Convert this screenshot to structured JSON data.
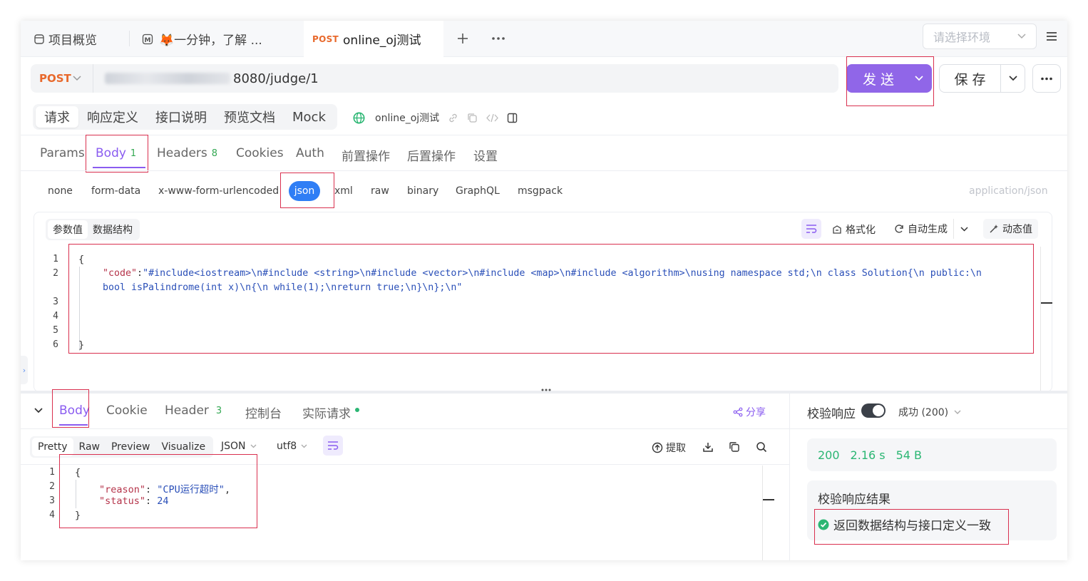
{
  "tabs": [
    {
      "label": "项目概览"
    },
    {
      "label": "🦊一分钟，了解 ..."
    },
    {
      "method": "POST",
      "label": "online_oj测试"
    }
  ],
  "env_placeholder": "请选择环境",
  "request": {
    "method": "POST",
    "url": "8080/judge/1",
    "send_label": "发 送",
    "save_label": "保 存"
  },
  "main_tabs": [
    "请求",
    "响应定义",
    "接口说明",
    "预览文档",
    "Mock"
  ],
  "api_name": "online_oj测试",
  "sub_tabs": [
    {
      "label": "Params"
    },
    {
      "label": "Body",
      "count": "1"
    },
    {
      "label": "Headers",
      "count": "8"
    },
    {
      "label": "Cookies"
    },
    {
      "label": "Auth"
    },
    {
      "label": "前置操作"
    },
    {
      "label": "后置操作"
    },
    {
      "label": "设置"
    }
  ],
  "body_types": [
    "none",
    "form-data",
    "x-www-form-urlencoded",
    "json",
    "xml",
    "raw",
    "binary",
    "GraphQL",
    "msgpack"
  ],
  "content_type": "application/json",
  "editor": {
    "tabs": [
      "参数值",
      "数据结构"
    ],
    "tools": {
      "format": "格式化",
      "auto": "自动生成",
      "dynamic": "动态值"
    },
    "line_numbers": [
      "1",
      "2",
      "3",
      "4",
      "5",
      "6"
    ],
    "lines": {
      "l1": "{",
      "l2_key": "\"code\"",
      "l2_colon": ":",
      "l2_val_a": "\"#include<iostream>\\n#include <string>\\n#include <vector>\\n#include <map>\\n#include <algorithm>\\nusing namespace std;\\n class Solution{\\n public:\\n",
      "l2_val_b": "bool isPalindrome(int x)\\n{\\n while(1);\\nreturn true;\\n}\\n};\\n\"",
      "l6": "}"
    }
  },
  "response": {
    "tabs": [
      {
        "label": "Body"
      },
      {
        "label": "Cookie"
      },
      {
        "label": "Header",
        "count": "3"
      },
      {
        "label": "控制台"
      },
      {
        "label": "实际请求"
      }
    ],
    "share": "分享",
    "views": [
      "Pretty",
      "Raw",
      "Preview",
      "Visualize"
    ],
    "format": "JSON",
    "encoding": "utf8",
    "extract": "提取",
    "line_numbers": [
      "1",
      "2",
      "3",
      "4"
    ],
    "lines": {
      "l1": "{",
      "reason_key": "\"reason\"",
      "reason_val": "\"CPU运行超时\"",
      "status_key": "\"status\"",
      "status_val": "24",
      "l4": "}"
    }
  },
  "validation": {
    "label": "校验响应",
    "result_status": "成功 (200)",
    "status_code": "200",
    "time": "2.16 s",
    "size": "54 B",
    "result_title": "校验响应结果",
    "result_msg": "返回数据结构与接口定义一致"
  },
  "colors": {
    "accent": "#9066e8",
    "post": "#e8692c",
    "success": "#2bb673",
    "highlight": "#d9304f"
  }
}
